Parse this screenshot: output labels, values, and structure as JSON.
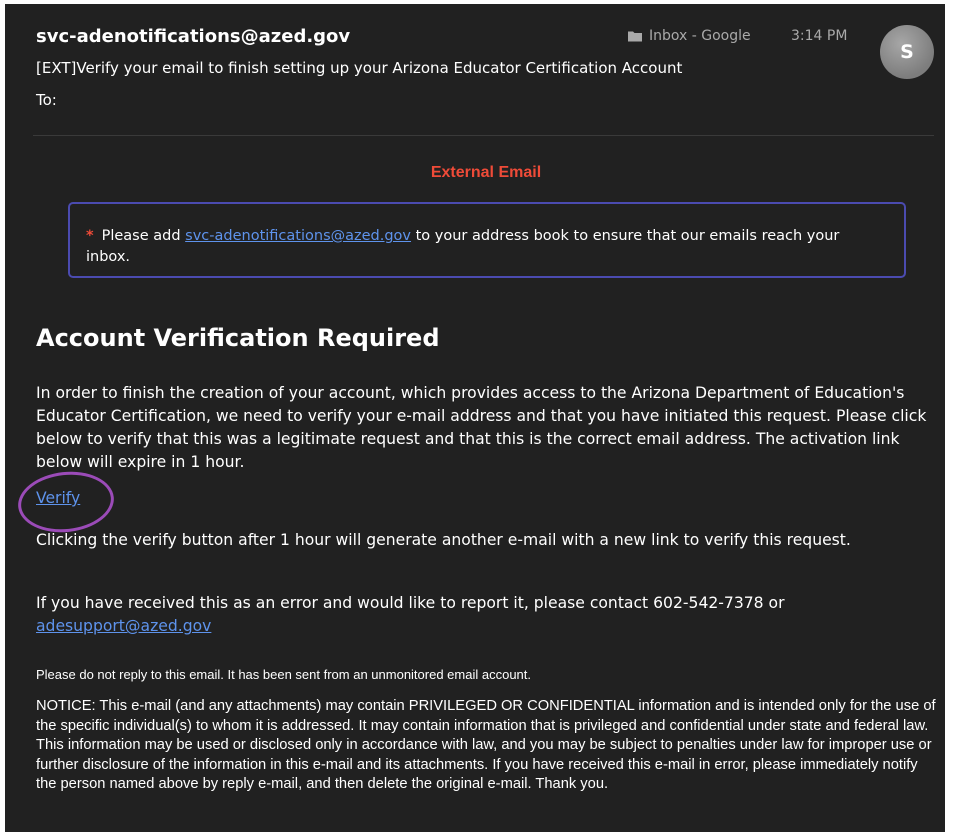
{
  "header": {
    "sender": "svc-adenotifications@azed.gov",
    "mailbox": "Inbox - Google",
    "time": "3:14 PM",
    "avatar_initial": "S",
    "subject": "[EXT]Verify your email to finish setting up your Arizona Educator Certification Account",
    "to_label": "To:"
  },
  "banner": {
    "external_label": "External Email",
    "notice": {
      "asterisk": "*",
      "before": "Please add ",
      "link": "svc-adenotifications@azed.gov",
      "after": " to your address book to ensure that our emails reach your inbox."
    }
  },
  "body": {
    "heading": "Account Verification Required",
    "para1": "In order to finish the creation of your account, which provides access to the Arizona Department of Education's Educator Certification, we need to verify your e-mail address and that you have initiated this request. Please click below to verify that this was a legitimate request and that this is the correct email address. The activation link below will expire in 1 hour.",
    "verify_link": "Verify",
    "para2": "Clicking the verify button after 1 hour will generate another e-mail with a new link to verify this request.",
    "para3_text": "If you have received this as an error and would like to report it, please contact 602-542-7378 or ",
    "para3_link": "adesupport@azed.gov",
    "no_reply": "Please do not reply to this email. It has been sent from an unmonitored email account.",
    "legal_notice": "NOTICE: This e-mail (and any attachments) may contain PRIVILEGED OR CONFIDENTIAL information and is intended only for the use of the specific individual(s) to whom it is addressed. It may contain information that is privileged and confidential under state and federal law. This information may be used or disclosed only in accordance with law, and you may be subject to penalties under law for improper use or further disclosure of the information in this e-mail and its attachments. If you have received this e-mail in error, please immediately notify the person named above by reply e-mail, and then delete the original e-mail. Thank you."
  },
  "colors": {
    "background": "#212121",
    "link": "#5e93ec",
    "external_red": "#ef4b38",
    "notice_border": "#4b4bb0",
    "annotation_circle": "#9b4bb8"
  },
  "icons": {
    "mailbox": "folder-icon"
  }
}
